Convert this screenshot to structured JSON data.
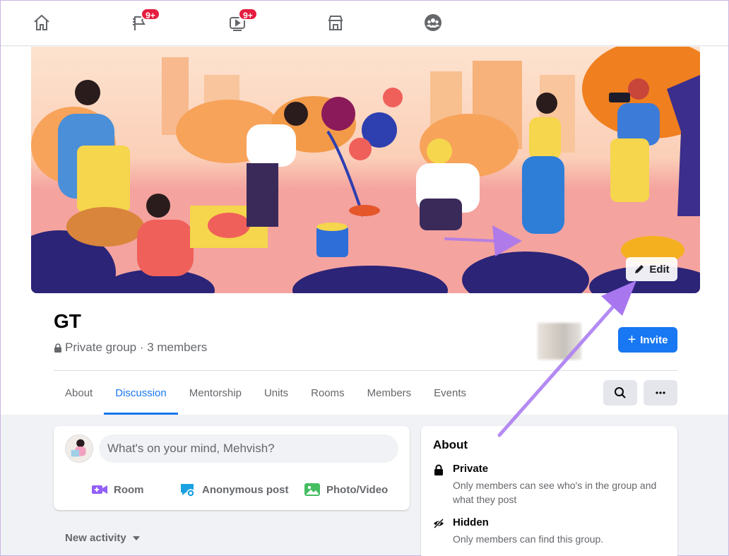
{
  "nav": {
    "icons": [
      {
        "name": "home-icon",
        "badge": ""
      },
      {
        "name": "pages-flag-icon",
        "badge": "9+"
      },
      {
        "name": "watch-video-icon",
        "badge": "9+"
      },
      {
        "name": "marketplace-icon",
        "badge": ""
      },
      {
        "name": "groups-icon",
        "badge": ""
      }
    ]
  },
  "cover": {
    "edit_label": "Edit"
  },
  "group": {
    "name": "GT",
    "meta": "Private group · 3 members",
    "invite_label": "Invite"
  },
  "tabs": [
    {
      "label": "About",
      "active": false
    },
    {
      "label": "Discussion",
      "active": true
    },
    {
      "label": "Mentorship",
      "active": false
    },
    {
      "label": "Units",
      "active": false
    },
    {
      "label": "Rooms",
      "active": false
    },
    {
      "label": "Members",
      "active": false
    },
    {
      "label": "Events",
      "active": false
    }
  ],
  "composer": {
    "placeholder": "What's on your mind, Mehvish?",
    "actions": [
      {
        "label": "Room",
        "icon": "video-room-icon",
        "color": "#9360f7"
      },
      {
        "label": "Anonymous post",
        "icon": "anonymous-post-icon",
        "color": "#1ba1e2"
      },
      {
        "label": "Photo/Video",
        "icon": "photo-video-icon",
        "color": "#45bd62"
      }
    ]
  },
  "feed": {
    "sort_label": "New activity"
  },
  "about": {
    "title": "About",
    "items": [
      {
        "heading": "Private",
        "description": "Only members can see who's in the group and what they post",
        "icon": "lock-icon"
      },
      {
        "heading": "Hidden",
        "description": "Only members can find this group.",
        "icon": "eye-slash-icon"
      }
    ]
  },
  "colors": {
    "accent": "#1877f2",
    "badge": "#e41e3f",
    "annotation_arrow": "#a877f0"
  }
}
